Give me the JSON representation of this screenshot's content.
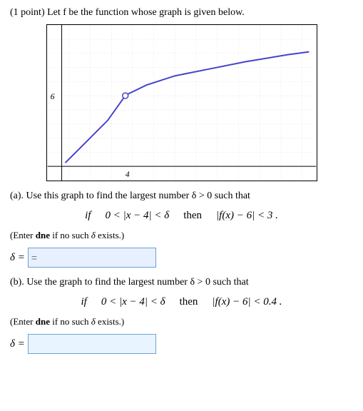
{
  "page": {
    "intro": "(1 point) Let f  be the function whose graph is given below.",
    "part_a": {
      "label": "(a). Use this graph to find the largest number δ > 0 such that",
      "condition_if": "if",
      "condition_ineq1": "0 < |x − 4| < δ",
      "condition_then": "then",
      "condition_ineq2": "|f(x) − 6| < 3 .",
      "dne_note": "(Enter dne if no such δ exists.)",
      "delta_label": "δ =",
      "placeholder": "="
    },
    "part_b": {
      "label": "(b). Use the graph to find the largest number δ > 0 such that",
      "condition_if": "if",
      "condition_ineq1": "0 < |x − 4| < δ",
      "condition_then": "then",
      "condition_ineq2": "|f(x) − 6| < 0.4 .",
      "dne_note": "(Enter dne if no such δ exists.)",
      "delta_label": "δ ="
    },
    "graph": {
      "x_label": "4",
      "y_label": "6"
    }
  }
}
